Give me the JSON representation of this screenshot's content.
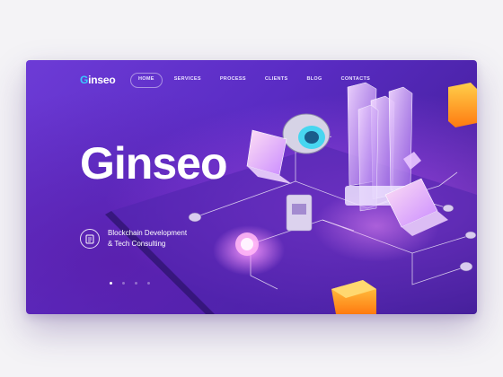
{
  "brand": {
    "logo_accent": "G",
    "logo_rest": "inseo",
    "accent_color": "#39c8ff"
  },
  "nav": {
    "items": [
      {
        "label": "HOME",
        "active": true
      },
      {
        "label": "SERVICES",
        "active": false
      },
      {
        "label": "PROCESS",
        "active": false
      },
      {
        "label": "CLIENTS",
        "active": false
      },
      {
        "label": "BLOG",
        "active": false
      },
      {
        "label": "CONTACTS",
        "active": false
      }
    ]
  },
  "hero": {
    "title": "Ginseo",
    "tagline_line1": "Blockchain Development",
    "tagline_line2": "& Tech Consulting",
    "tagline_icon": "document-icon"
  },
  "slider": {
    "total": 4,
    "current": 1
  },
  "colors": {
    "background": "#5a2cc4",
    "page": "#f4f3f6",
    "cube_orange": "#ffa21a",
    "glow_pink": "#e070ff"
  }
}
